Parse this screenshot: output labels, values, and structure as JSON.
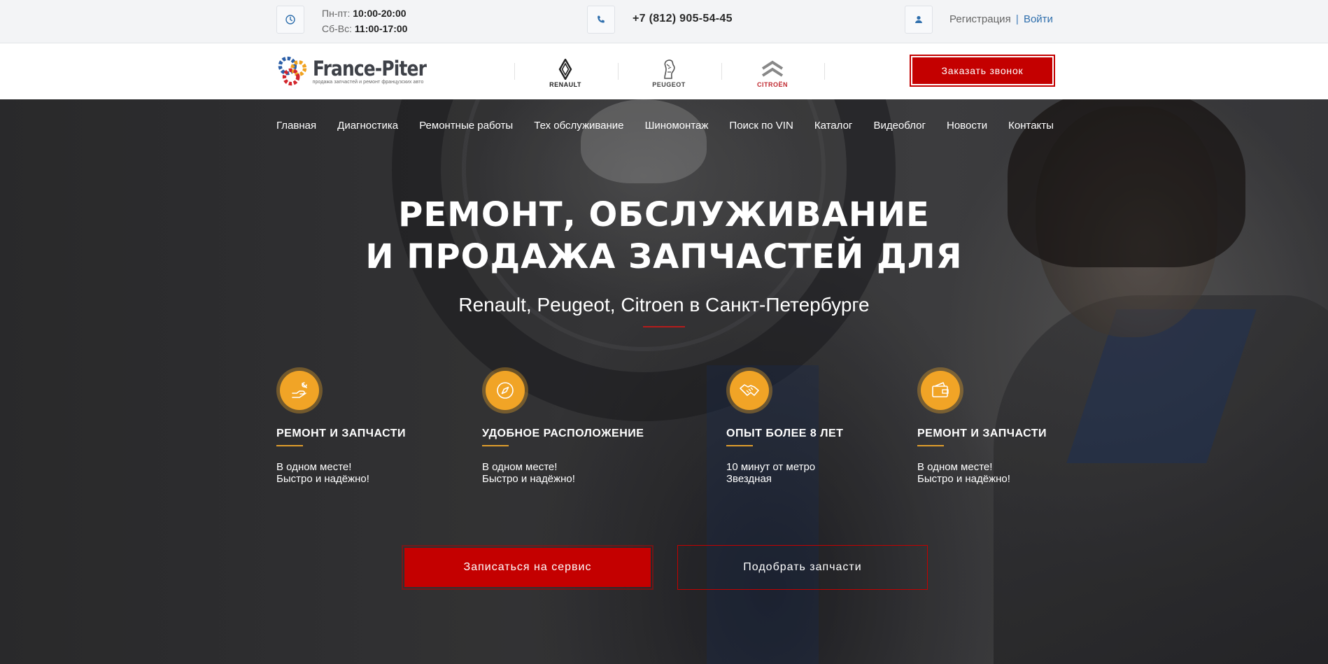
{
  "topbar": {
    "hours": {
      "weekday_label": "Пн-пт:",
      "weekday_time": "10:00-20:00",
      "weekend_label": "Сб-Вс:",
      "weekend_time": "11:00-17:00",
      "icon": "clock-icon"
    },
    "phone": {
      "number": "+7 (812) 905-54-45",
      "icon": "phone-icon"
    },
    "auth": {
      "register": "Регистрация",
      "separator": "|",
      "login": "Войти",
      "icon": "user-icon"
    }
  },
  "header": {
    "logo": {
      "title": "France-Piter",
      "subtitle": "продажа запчастей и ремонт французских авто"
    },
    "brands": [
      {
        "name": "RENAULT",
        "icon": "renault-logo-icon"
      },
      {
        "name": "PEUGEOT",
        "icon": "peugeot-logo-icon"
      },
      {
        "name": "CITROËN",
        "icon": "citroen-logo-icon"
      }
    ],
    "callback_label": "Заказать звонок"
  },
  "nav": {
    "items": [
      "Главная",
      "Диагностика",
      "Ремонтные работы",
      "Тех обслуживание",
      "Шиномонтаж",
      "Поиск по VIN",
      "Каталог",
      "Видеоблог",
      "Новости",
      "Контакты"
    ]
  },
  "hero": {
    "headline_line1": "РЕМОНТ, ОБСЛУЖИВАНИЕ",
    "headline_line2": "И ПРОДАЖА ЗАПЧАСТЕЙ ДЛЯ",
    "subline": "Renault, Peugeot, Citroen в Санкт-Петербурге",
    "features": [
      {
        "title": "РЕМОНТ И ЗАПЧАСТИ",
        "line1": "В одном месте!",
        "line2": "Быстро и надёжно!",
        "icon": "repair-hand-icon"
      },
      {
        "title": "УДОБНОЕ РАСПОЛОЖЕНИЕ",
        "line1": "В одном месте!",
        "line2": "Быстро и надёжно!",
        "icon": "compass-icon"
      },
      {
        "title": "ОПЫТ БОЛЕЕ 8 ЛЕТ",
        "line1": "10 минут от метро",
        "line2": "Звездная",
        "icon": "handshake-icon"
      },
      {
        "title": "РЕМОНТ И ЗАПЧАСТИ",
        "line1": "В одном месте!",
        "line2": "Быстро и надёжно!",
        "icon": "wallet-icon"
      }
    ],
    "cta_primary": "Записаться на сервис",
    "cta_secondary": "Подобрать запчасти"
  },
  "colors": {
    "accent_red": "#c40000",
    "feature_orange": "#f1a426",
    "link_blue": "#2f6fad"
  }
}
